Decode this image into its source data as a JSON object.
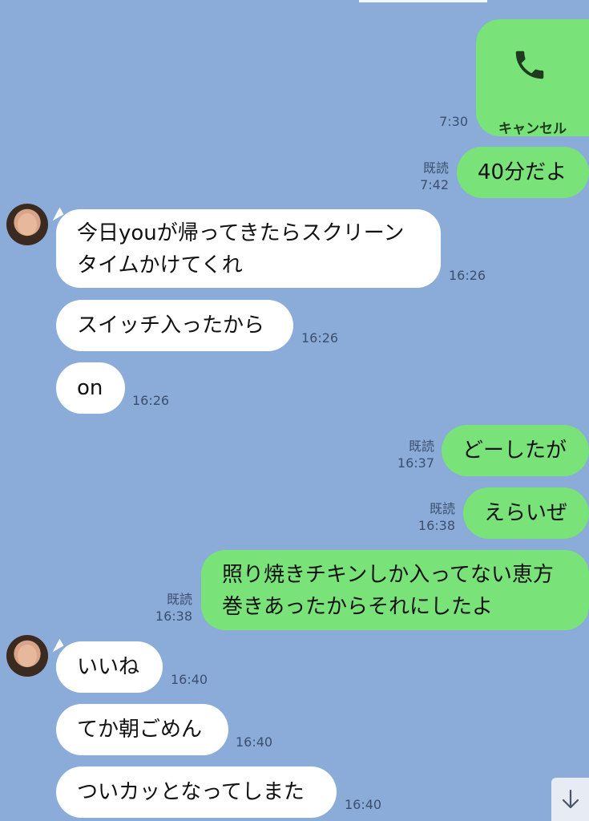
{
  "call": {
    "label": "キャンセル",
    "time": "7:30",
    "icon": "phone-icon"
  },
  "messages": {
    "m1": {
      "text": "40分だよ",
      "read": "既読",
      "time": "7:42"
    },
    "m2": {
      "line1": "今日youが帰ってきたらスクリーン",
      "line2": "タイムかけてくれ",
      "time": "16:26"
    },
    "m3": {
      "text": "スイッチ入ったから",
      "time": "16:26"
    },
    "m4": {
      "text": "on",
      "time": "16:26"
    },
    "m5": {
      "text": "どーしたが",
      "read": "既読",
      "time": "16:37"
    },
    "m6": {
      "text": "えらいぜ",
      "read": "既読",
      "time": "16:38"
    },
    "m7": {
      "line1": "照り焼きチキンしか入ってない恵方",
      "line2": "巻きあったからそれにしたよ",
      "read": "既読",
      "time": "16:38"
    },
    "m8": {
      "text": "いいね",
      "time": "16:40"
    },
    "m9": {
      "text": "てか朝ごめん",
      "time": "16:40"
    },
    "m10": {
      "text": "ついカッとなってしまた",
      "time": "16:40"
    }
  },
  "scroll_down_icon": "arrow-down-icon",
  "colors": {
    "background": "#8babd8",
    "outgoing": "#79e278",
    "incoming": "#ffffff"
  }
}
